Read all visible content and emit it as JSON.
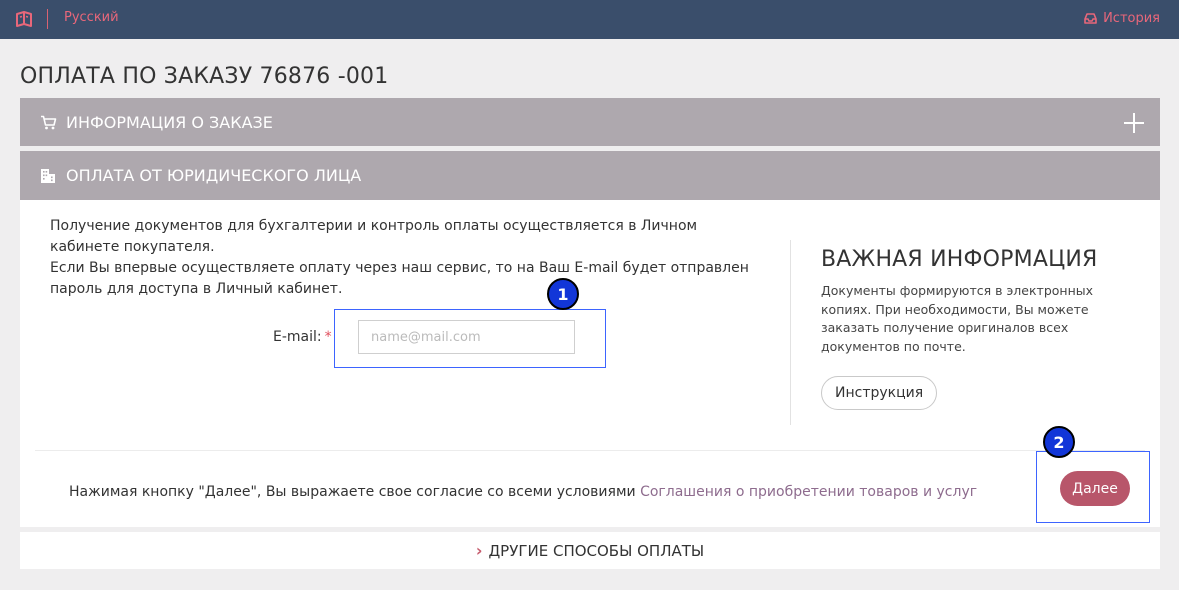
{
  "header": {
    "logo_icon": "book-icon",
    "language": "Русский",
    "history_icon": "inbox-icon",
    "history_label": "История",
    "bg_color": "#3a4e6b",
    "accent_color": "#e8677a"
  },
  "page_title": "ОПЛАТА ПО ЗАКАЗУ 76876 -001",
  "order_info": {
    "icon": "cart-icon",
    "label": "ИНФОРМАЦИЯ О ЗАКАЗЕ",
    "expand_icon": "plus-icon"
  },
  "legal": {
    "icon": "building-icon",
    "label": "ОПЛАТА ОТ ЮРИДИЧЕСКОГО ЛИЦА",
    "description_line1": "Получение документов для бухгалтерии и контроль оплаты осуществляется в Личном кабинете покупателя.",
    "description_line2": "Если Вы впервые осуществляете оплату через наш сервис, то на Ваш E-mail будет отправлен пароль для доступа в Личный кабинет.",
    "email_label": "E-mail:",
    "required_mark": "*",
    "email_value": "",
    "email_placeholder": "name@mail.com"
  },
  "important": {
    "title": "ВАЖНАЯ ИНФОРМАЦИЯ",
    "text": "Документы формируются в электронных копиях. При необходимости, Вы можете заказать получение оригиналов всех документов по почте.",
    "button_label": "Инструкция"
  },
  "agreement": {
    "text": "Нажимая кнопку \"Далее\", Вы выражаете свое согласие со всеми условиями ",
    "link_text": "Соглашения о приобретении товаров и услуг"
  },
  "next_button": {
    "label": "Далее",
    "color": "#b8566a"
  },
  "other_methods": {
    "icon": "chevron-right-icon",
    "label": "ДРУГИЕ СПОСОБЫ ОПЛАТЫ"
  },
  "annotations": {
    "marker1": "1",
    "marker2": "2"
  }
}
